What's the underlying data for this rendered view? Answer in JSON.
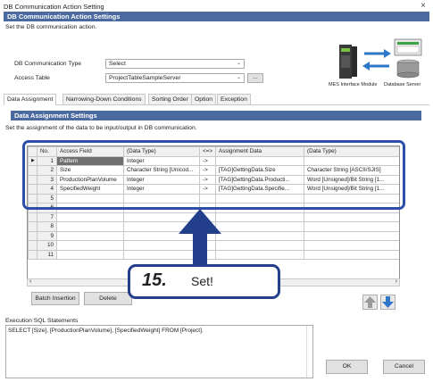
{
  "window": {
    "title": "DB Communication Action Setting",
    "close": "×"
  },
  "header": {
    "section_title": "DB Communication Action Settings",
    "instruction": "Set the DB communication action.",
    "type_label": "DB Communication Type",
    "type_value": "Select",
    "table_label": "Access Table",
    "table_value": "ProjectTableSampleServer",
    "browse_label": "...",
    "diagram_left": "MES Interface Module",
    "diagram_right": "Database Server"
  },
  "tabs": [
    "Data Assignment",
    "Narrowing-Down Conditions",
    "Sorting Order",
    "Option",
    "Exception"
  ],
  "assignment": {
    "section_title": "Data Assignment Settings",
    "instruction": "Set the assignment of the data to be input/output in DB communication.",
    "columns": [
      "No.",
      "Access Field",
      "(Data Type)",
      "<=>",
      "Assignment Data",
      "(Data Type)"
    ],
    "rows": [
      [
        "1",
        "Pattern",
        "Integer",
        "->",
        "",
        ""
      ],
      [
        "2",
        "Size",
        "Character String [Unicod...",
        "->",
        "[TAG]GettingData.Size",
        "Character String [ASCII/SJIS]"
      ],
      [
        "3",
        "ProductionPlanVolume",
        "Integer",
        "->",
        "[TAG]GettingData.Producti...",
        "Word [Unsigned]/Bit String [1..."
      ],
      [
        "4",
        "SpecifiedWeight",
        "Integer",
        "->",
        "[TAG]GettingData.Specifie...",
        "Word [Unsigned]/Bit String [1..."
      ],
      [
        "5",
        "",
        "",
        "",
        "",
        ""
      ],
      [
        "6",
        "",
        "",
        "",
        "",
        ""
      ],
      [
        "7",
        "",
        "",
        "",
        "",
        ""
      ],
      [
        "8",
        "",
        "",
        "",
        "",
        ""
      ],
      [
        "9",
        "",
        "",
        "",
        "",
        ""
      ],
      [
        "10",
        "",
        "",
        "",
        "",
        ""
      ],
      [
        "11",
        "",
        "",
        "",
        "",
        ""
      ]
    ],
    "batch_label": "Batch Insertion",
    "delete_label": "Delete"
  },
  "callout": {
    "step": "15.",
    "text": "Set!"
  },
  "sql": {
    "label": "Execution SQL Statements",
    "statement": "SELECT [Size], [ProductionPlanVolume], [SpecifiedWeight] FROM [Project]."
  },
  "buttons": {
    "ok": "OK",
    "cancel": "Cancel"
  },
  "colors": {
    "section_bar": "#4a6aa0",
    "highlight": "#2e4fa7",
    "arrow": "#233e8a",
    "move_arrow": "#2e76c7"
  }
}
